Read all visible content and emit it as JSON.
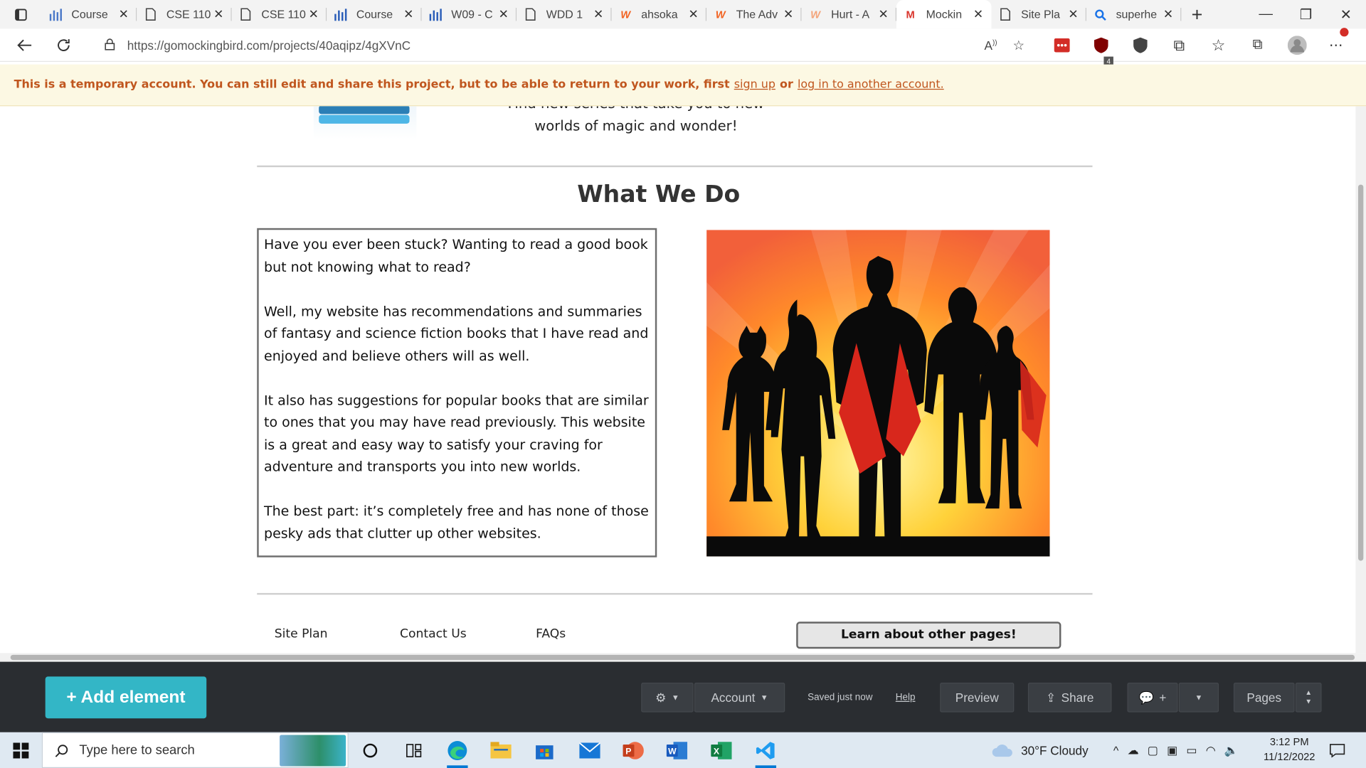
{
  "browser": {
    "tabs": [
      {
        "title": "Course",
        "icon": "bar-chart-icon",
        "active": false
      },
      {
        "title": "CSE 110",
        "icon": "document-icon",
        "active": false
      },
      {
        "title": "CSE 110",
        "icon": "document-icon",
        "active": false
      },
      {
        "title": "Course",
        "icon": "bar-chart-icon",
        "active": false
      },
      {
        "title": "W09 - C",
        "icon": "bar-chart-icon",
        "active": false
      },
      {
        "title": "WDD 1",
        "icon": "document-icon",
        "active": false
      },
      {
        "title": "ahsoka",
        "icon": "w-orange-icon",
        "active": false
      },
      {
        "title": "The Adv",
        "icon": "w-orange-icon",
        "active": false
      },
      {
        "title": "Hurt - A",
        "icon": "w-orange-icon",
        "active": false
      },
      {
        "title": "Mockin",
        "icon": "m-red-icon",
        "active": true
      },
      {
        "title": "Site Pla",
        "icon": "document-icon",
        "active": false
      },
      {
        "title": "superhe",
        "icon": "search-icon",
        "active": false
      }
    ],
    "url": "https://gomockingbird.com/projects/40aqipz/4gXVnC",
    "ext_badge": "4"
  },
  "notice": {
    "text": "This is a temporary account. You can still edit and share this project, but to be able to return to your work, first",
    "signup": "sign up",
    "or": "or",
    "login": "log in to another account."
  },
  "page": {
    "tagline_cut": "Find new series that take you to new",
    "tagline": "worlds of magic and wonder!",
    "section_title": "What We Do",
    "paragraphs": [
      "Have you ever been stuck? Wanting to read a good book but not knowing what to read?",
      "Well, my website has recommendations and summaries of fantasy and science fiction books that I have read and enjoyed and believe others will as well.",
      "It also has suggestions for popular books that are similar to ones that you may have read previously. This website is a great and easy way to satisfy your craving for adventure and transports you into new worlds.",
      "The best part: it’s completely free and has none of those pesky ads that clutter up other websites."
    ],
    "footer_links": [
      "Site Plan",
      "Contact Us",
      "FAQs"
    ],
    "learn_button": "Learn about other pages!"
  },
  "editor": {
    "add_element": "+ Add element",
    "account": "Account",
    "saved": "Saved just now",
    "help": "Help",
    "preview": "Preview",
    "share": "Share",
    "comment_plus": "+",
    "pages": "Pages"
  },
  "taskbar": {
    "search_placeholder": "Type here to search",
    "weather": "30°F  Cloudy",
    "time": "3:12 PM",
    "date": "11/12/2022"
  },
  "colors": {
    "accent_teal": "#33b6c6",
    "notice_text": "#c0561e",
    "notice_bg": "#fcf8e3",
    "editor_bg": "#2a2d31"
  }
}
